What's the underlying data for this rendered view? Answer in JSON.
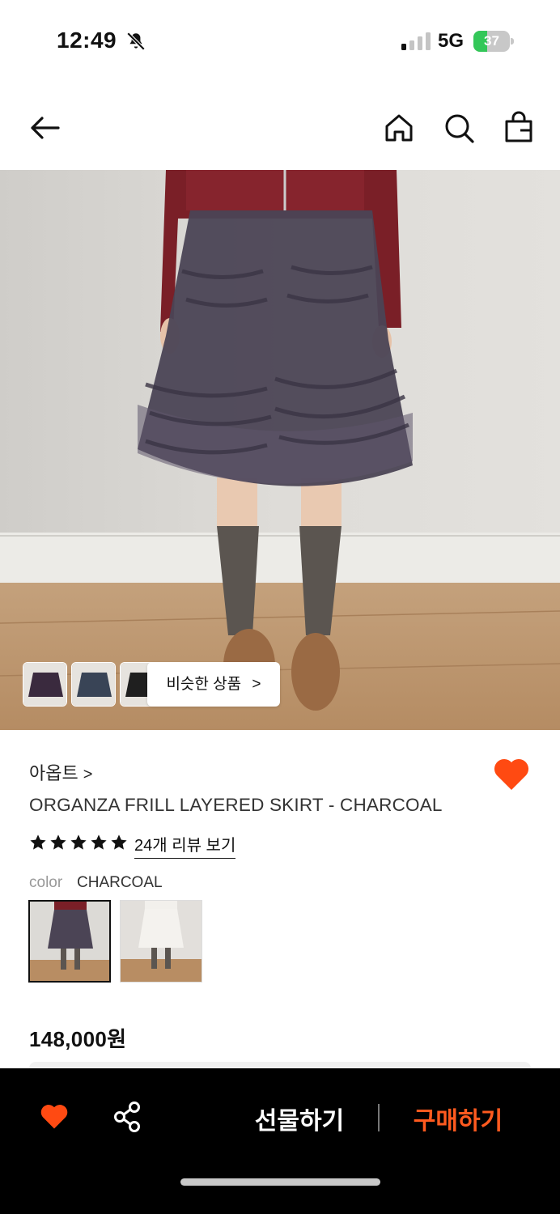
{
  "status_bar": {
    "time": "12:49",
    "network": "5G",
    "battery": "37",
    "battery_level": 0.37,
    "icons": [
      "bell-slash-icon",
      "signal-icon",
      "battery-charging-icon"
    ]
  },
  "top_nav": {
    "icons": [
      "back-arrow-icon",
      "home-icon",
      "search-icon",
      "shopping-bag-icon"
    ]
  },
  "hero": {
    "similar_button_label": "비슷한 상품",
    "similar_button_chevron": ">",
    "thumbnail_count": 3
  },
  "product": {
    "brand": "아옵트",
    "brand_chevron": ">",
    "title": "ORGANZA FRILL LAYERED SKIRT - CHARCOAL",
    "rating_stars": 5,
    "review_link": "24개 리뷰 보기",
    "color_label": "color",
    "color_value": "CHARCOAL",
    "price": "148,000원",
    "wishlisted": true
  },
  "bottom_bar": {
    "gift_label": "선물하기",
    "buy_label": "구매하기",
    "icons": [
      "heart-icon",
      "share-icon"
    ]
  },
  "colors": {
    "accent": "#ff5a1f",
    "heart": "#ff4a12",
    "bottom_bar_bg": "#000000",
    "battery_green": "#34c759"
  }
}
